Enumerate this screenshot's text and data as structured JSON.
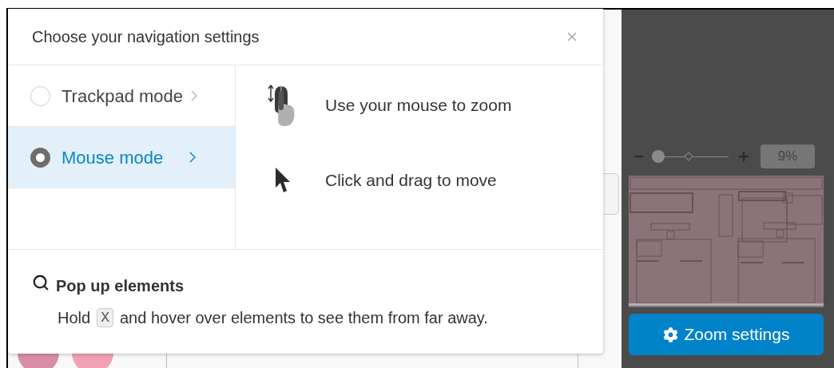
{
  "dialog": {
    "title": "Choose your navigation settings",
    "modes": [
      {
        "label": "Trackpad mode",
        "selected": false
      },
      {
        "label": "Mouse mode",
        "selected": true
      }
    ],
    "instructions": [
      {
        "kind": "mouse-zoom",
        "text": "Use your mouse to zoom"
      },
      {
        "kind": "pointer",
        "text": "Click and drag to move"
      }
    ],
    "tip": {
      "title": "Pop up elements",
      "before": "Hold",
      "key": "X",
      "after": "and hover over elements to see them from far away."
    }
  },
  "zoom_panel": {
    "level": 0.05,
    "percent": "9%",
    "button": "Zoom settings"
  }
}
